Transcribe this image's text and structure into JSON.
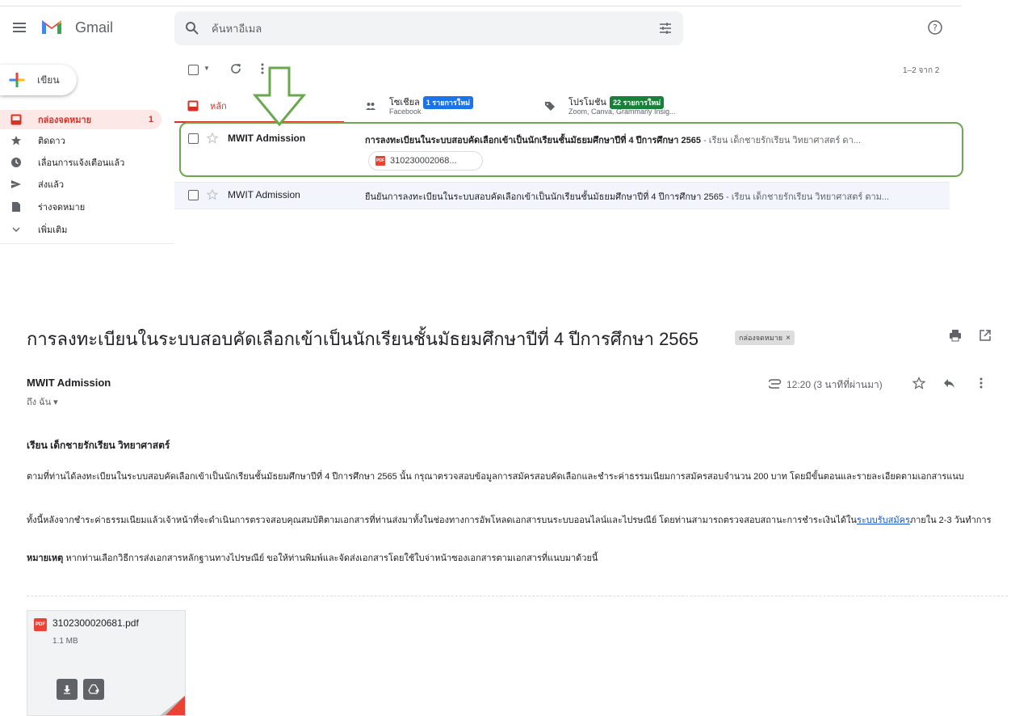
{
  "app": {
    "name": "Gmail"
  },
  "search": {
    "placeholder": "ค้นหาอีเมล"
  },
  "compose": {
    "label": "เขียน"
  },
  "sidebar": {
    "items": [
      {
        "label": "กล่องจดหมาย",
        "count": "1",
        "icon": "inbox-icon"
      },
      {
        "label": "ติดดาว",
        "icon": "star-icon"
      },
      {
        "label": "เลื่อนการแจ้งเตือนแล้ว",
        "icon": "clock-icon"
      },
      {
        "label": "ส่งแล้ว",
        "icon": "send-icon"
      },
      {
        "label": "ร่างจดหมาย",
        "icon": "draft-icon"
      },
      {
        "label": "เพิ่มเติม",
        "icon": "chevron-down-icon"
      }
    ]
  },
  "toolbar": {
    "pager": "1–2 จาก 2"
  },
  "tabs": {
    "primary": {
      "label": "หลัก"
    },
    "social": {
      "label": "โซเชียล",
      "badge": "1 รายการใหม่",
      "sub": "Facebook"
    },
    "promotions": {
      "label": "โปรโมชัน",
      "badge": "22 รายการใหม่",
      "sub": "Zoom, Canva, Grammarly Insig..."
    }
  },
  "emails": [
    {
      "sender": "MWIT Admission",
      "subject": "การลงทะเบียนในระบบสอบคัดเลือกเข้าเป็นนักเรียนชั้นมัธยมศึกษาปีที่ 4 ปีการศึกษา 2565",
      "snippet": " - เรียน เด็กชายรักเรียน วิทยาศาสตร์ ดา...",
      "attachment": "310230002068..."
    },
    {
      "sender": "MWIT Admission",
      "subject": "ยืนยันการลงทะเบียนในระบบสอบคัดเลือกเข้าเป็นนักเรียนชั้นมัธยมศึกษาปีที่ 4 ปีการศึกษา 2565",
      "snippet": " - เรียน เด็กชายรักเรียน วิทยาศาสตร์ ตาม..."
    }
  ],
  "message": {
    "title": "การลงทะเบียนในระบบสอบคัดเลือกเข้าเป็นนักเรียนชั้นมัธยมศึกษาปีที่ 4 ปีการศึกษา 2565",
    "label": "กล่องจดหมาย",
    "from": "MWIT Admission",
    "to": "ถึง ฉัน",
    "time": "12:20 (3 นาทีที่ผ่านมา)",
    "greeting": "เรียน เด็กชายรักเรียน วิทยาศาสตร์",
    "p1": "ตามที่ท่านได้ลงทะเบียนในระบบสอบคัดเลือกเข้าเป็นนักเรียนชั้นมัธยมศึกษาปีที่ 4 ปีการศึกษา 2565 นั้น กรุณาตรวจสอบข้อมูลการสมัครสอบคัดเลือกและชำระค่าธรรมเนียมการสมัครสอบจำนวน 200 บาท โดยมีขั้นตอนและรายละเอียดตามเอกสารแนบ",
    "p2_before": "ทั้งนี้หลังจากชำระค่าธรรมเนียมแล้วเจ้าหน้าที่จะดำเนินการตรวจสอบคุณสมบัติตามเอกสารที่ท่านส่งมาทั้งในช่องทางการอัพโหลดเอกสารบนระบบออนไลน์และไปรษณีย์ โดยท่านสามารถตรวจสอบสถานะการชำระเงินได้ใน",
    "p2_link": "ระบบรับสมัคร",
    "p2_after": "ภายใน 2-3 วันทำการ",
    "note_label": "หมายเหตุ",
    "note_text": " หากท่านเลือกวิธีการส่งเอกสารหลักฐานทางไปรษณีย์ ขอให้ท่านพิมพ์และจัดส่งเอกสารโดยใช้ใบจ่าหน้าซองเอกสารตามเอกสารที่แนบมาด้วยนี้",
    "attachment": {
      "name": "3102300020681.pdf",
      "size": "1.1 MB",
      "type_label": "PDF"
    }
  },
  "colors": {
    "accent_red": "#d93025",
    "social_badge": "#1a73e8",
    "promo_badge": "#188038",
    "highlight": "#6aa84f"
  }
}
